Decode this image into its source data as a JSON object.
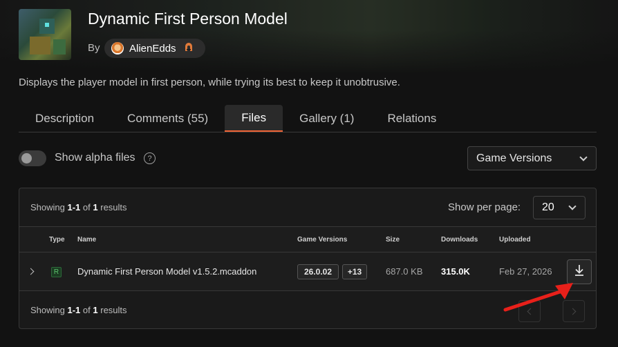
{
  "header": {
    "title": "Dynamic First Person Model",
    "by_label": "By",
    "author": "AlienEdds",
    "summary": "Displays the player model in first person, while trying its best to keep it unobtrusive."
  },
  "tabs": [
    {
      "label": "Description",
      "active": false
    },
    {
      "label": "Comments (55)",
      "active": false
    },
    {
      "label": "Files",
      "active": true
    },
    {
      "label": "Gallery (1)",
      "active": false
    },
    {
      "label": "Relations",
      "active": false
    }
  ],
  "filters": {
    "alpha_toggle_label": "Show alpha files",
    "alpha_toggle_on": false,
    "help_glyph": "?",
    "game_versions_label": "Game Versions"
  },
  "table": {
    "showing_prefix": "Showing",
    "showing_range": "1-1",
    "showing_of": "of",
    "showing_total": "1",
    "showing_suffix": "results",
    "per_page_label": "Show per page:",
    "per_page_value": "20",
    "columns": {
      "type": "Type",
      "name": "Name",
      "game_versions": "Game Versions",
      "size": "Size",
      "downloads": "Downloads",
      "uploaded": "Uploaded"
    },
    "rows": [
      {
        "type_badge": "R",
        "name": "Dynamic First Person Model v1.5.2.mcaddon",
        "game_version": "26.0.02",
        "more_versions": "+13",
        "size": "687.0 KB",
        "downloads": "315.0K",
        "uploaded": "Feb 27, 2026"
      }
    ]
  },
  "colors": {
    "accent": "#f16436",
    "annotation_arrow": "#e8201a",
    "release_badge": "#5ec46e"
  }
}
